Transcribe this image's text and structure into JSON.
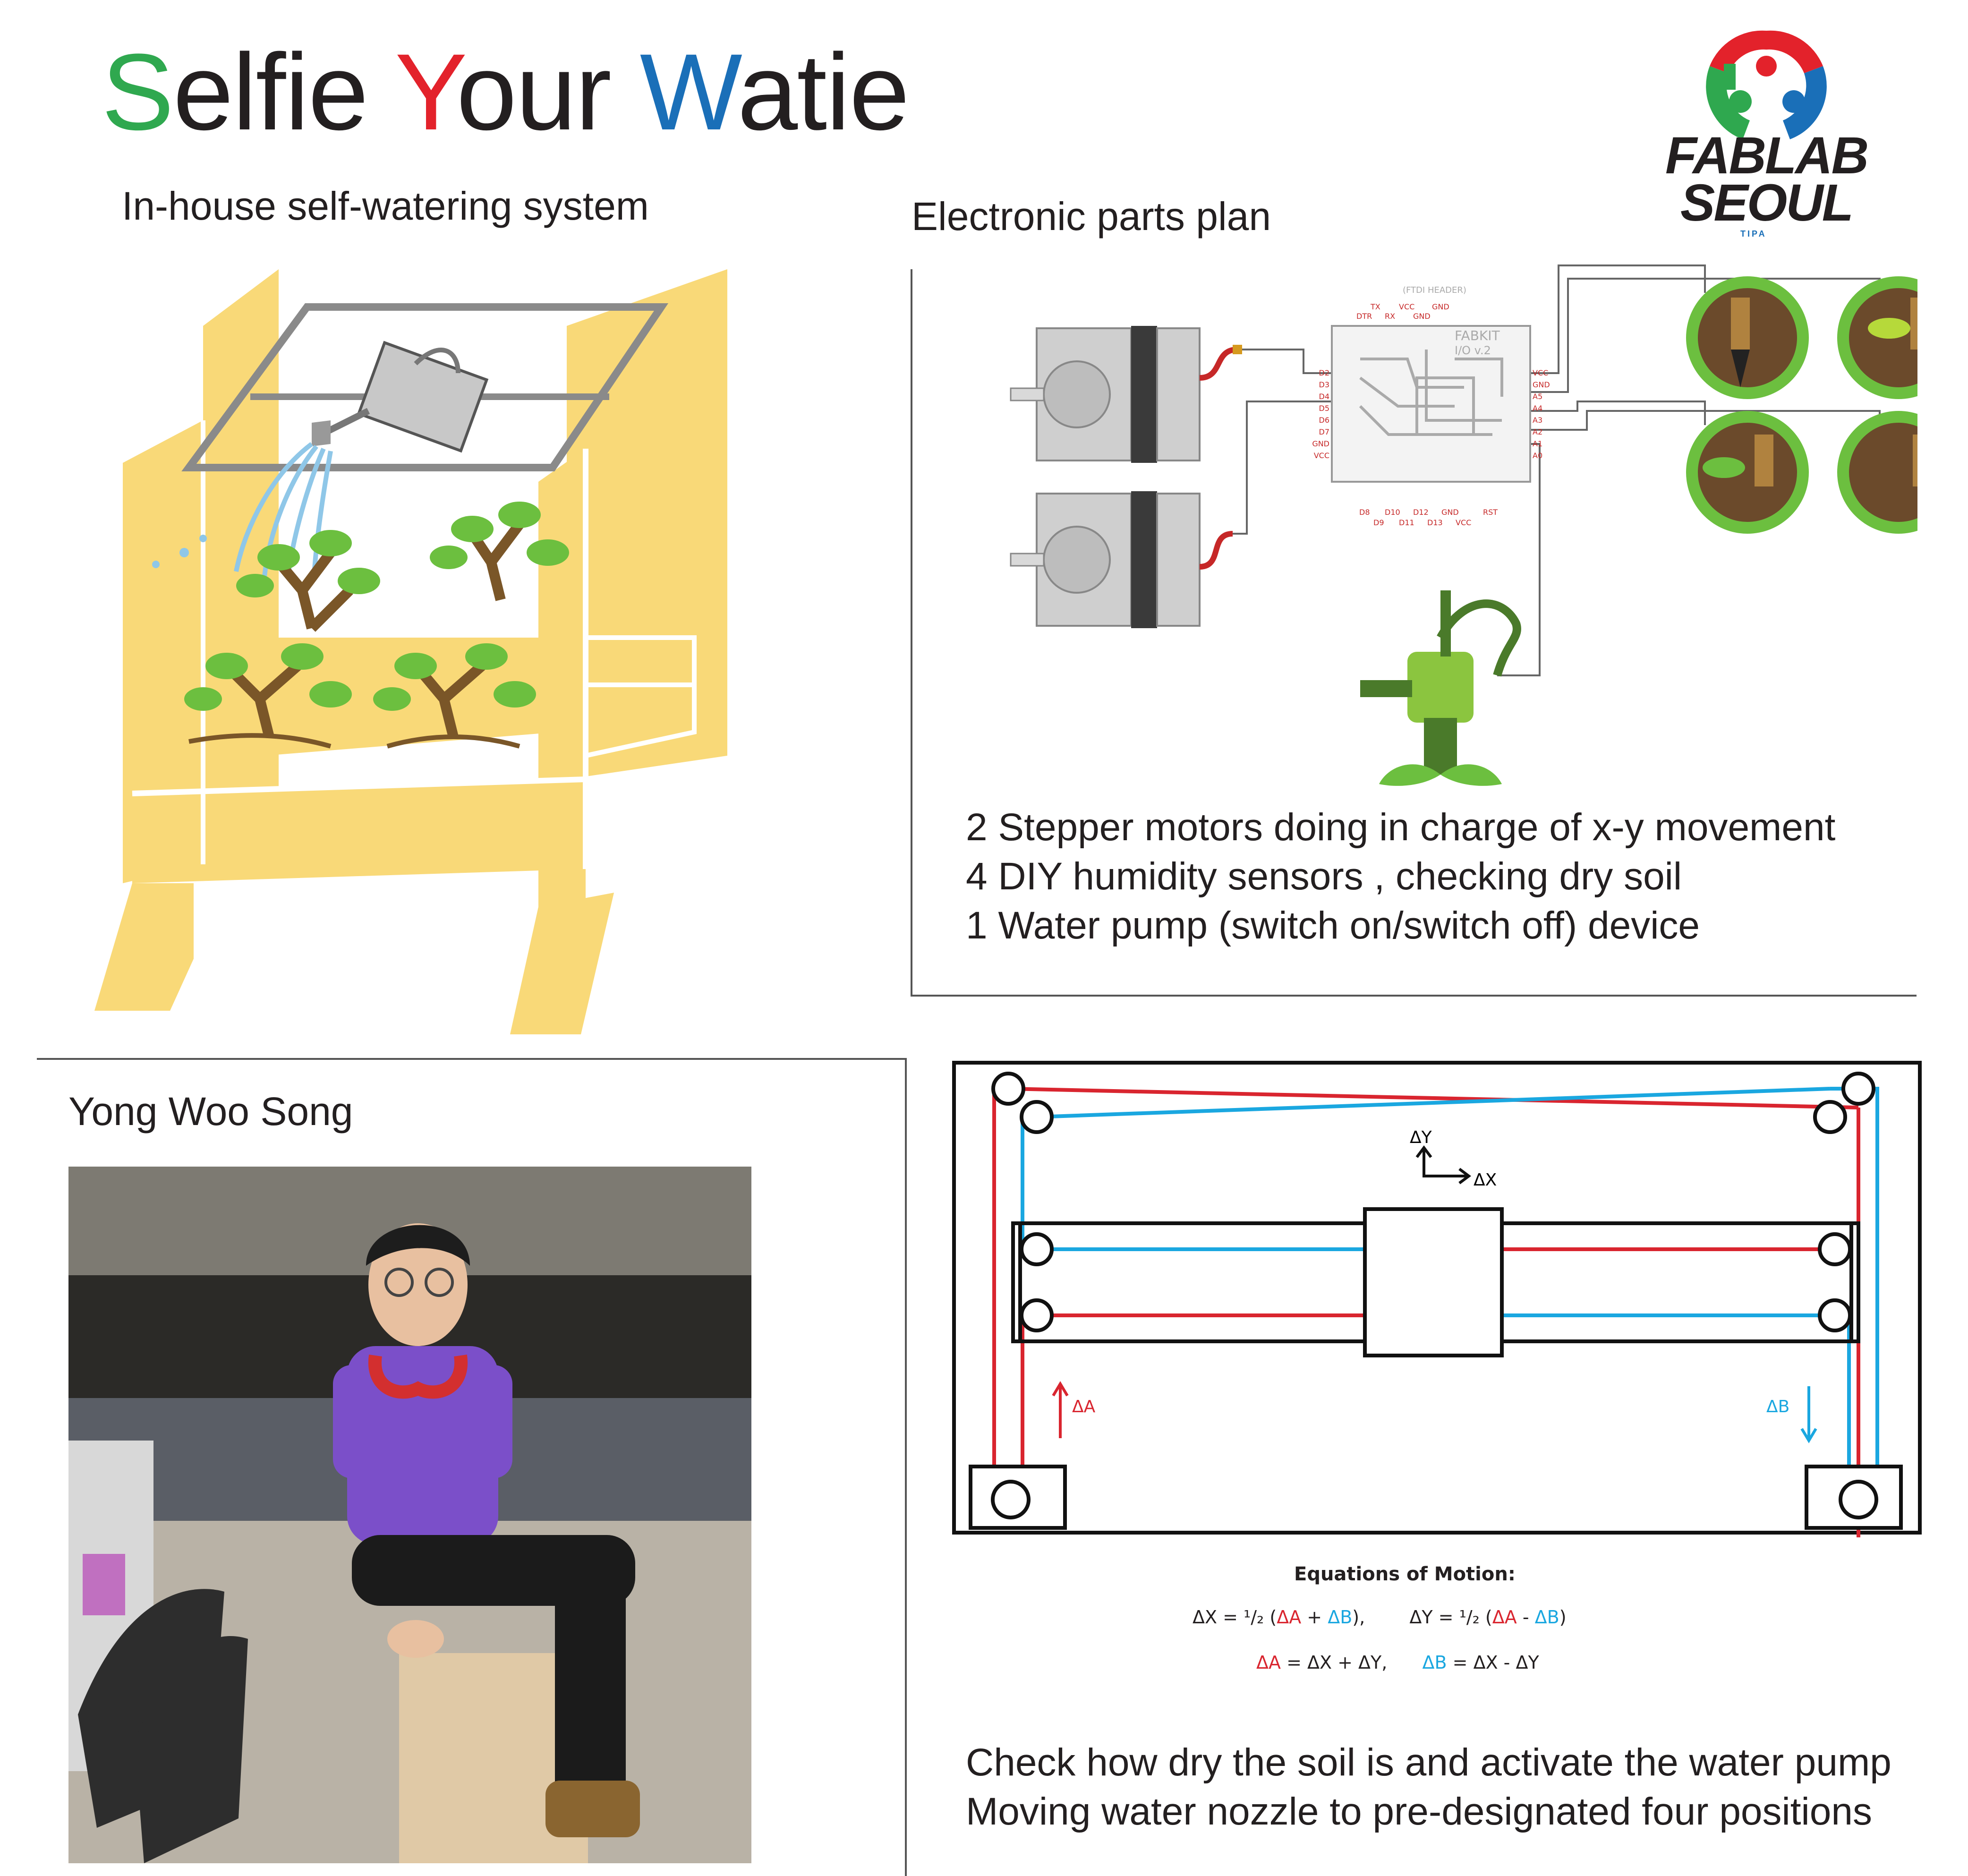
{
  "title": {
    "words": [
      {
        "initial": "S",
        "rest": "elfie",
        "initial_color": "#2fa84f"
      },
      {
        "initial": "Y",
        "rest": "our",
        "initial_color": "#e3222b"
      },
      {
        "initial": "W",
        "rest": "atie",
        "initial_color": "#1a6fb8"
      }
    ]
  },
  "subtitle": "In-house self-watering system",
  "logo": {
    "line1": "FABLAB",
    "line2": "SEOUL",
    "tag": "TIPA",
    "colors": [
      "#e3222b",
      "#2fa84f",
      "#1a6fb8"
    ]
  },
  "electronics": {
    "heading": "Electronic parts plan",
    "board": {
      "header_label": "(FTDI HEADER)",
      "top_pins": [
        "DTR",
        "TX",
        "RX",
        "VCC",
        "GND",
        "GND"
      ],
      "name_line1": "FABKIT",
      "name_line2": "I/O v.2",
      "left_pins": [
        "D2",
        "D3",
        "D4",
        "D5",
        "D6",
        "D7",
        "GND",
        "VCC"
      ],
      "right_pins": [
        "VCC",
        "GND",
        "A5",
        "A4",
        "A3",
        "A2",
        "A1",
        "A0"
      ],
      "bottom_pins": [
        "D8",
        "D9",
        "D10",
        "D11",
        "D12",
        "D13",
        "GND",
        "VCC",
        "RST"
      ]
    },
    "description": [
      "2 Stepper motors doing in charge of x-y movement",
      "4 DIY humidity sensors , checking dry soil",
      "1 Water pump (switch on/switch off) device"
    ]
  },
  "author": {
    "name": "Yong Woo Song"
  },
  "motion": {
    "dy_label": "ΔY",
    "dx_label": "ΔX",
    "da_label": "ΔA",
    "db_label": "ΔB",
    "colors": {
      "a": "#e3222b",
      "b": "#1aa7e0"
    },
    "equations_title": "Equations of Motion:",
    "eq1_left": "ΔX = ¹/₂ (",
    "eq1_a": "ΔA",
    "eq1_plus": " + ",
    "eq1_b": "ΔB",
    "eq1_close": "),",
    "eq2_left": "ΔY = ¹/₂ (",
    "eq2_a": "ΔA",
    "eq2_minus": " - ",
    "eq2_b": "ΔB",
    "eq2_close": ")",
    "eq3_a": "ΔA",
    "eq3_rest": " = ΔX + ΔY,",
    "eq4_b": "ΔB",
    "eq4_rest": " = ΔX - ΔY"
  },
  "summary": [
    "Check how dry the soil is and activate the water pump",
    "Moving water nozzle to pre-designated four positions"
  ]
}
